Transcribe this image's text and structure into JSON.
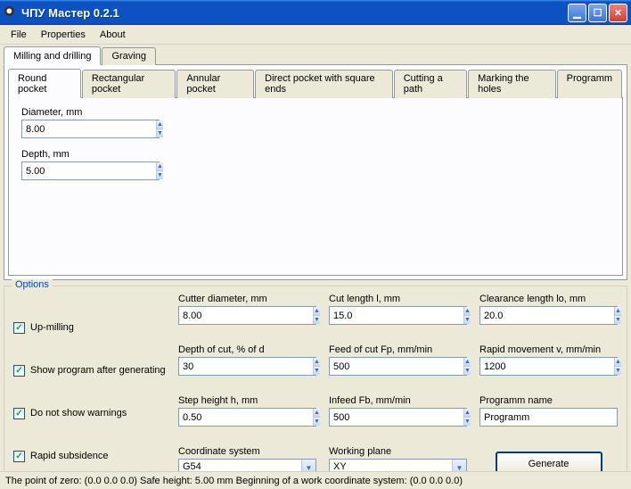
{
  "window": {
    "title": "ЧПУ Мастер 0.2.1"
  },
  "menu": {
    "file": "File",
    "properties": "Properties",
    "about": "About"
  },
  "outerTabs": {
    "milling": "Milling and drilling",
    "graving": "Graving"
  },
  "innerTabs": {
    "round": "Round pocket",
    "rect": "Rectangular pocket",
    "annular": "Annular pocket",
    "direct": "Direct pocket with square ends",
    "cutting": "Cutting a path",
    "marking": "Marking the holes",
    "programm": "Programm"
  },
  "roundPocket": {
    "diameterLabel": "Diameter, mm",
    "diameterValue": "8.00",
    "depthLabel": "Depth, mm",
    "depthValue": "5.00"
  },
  "options": {
    "legend": "Options",
    "upMilling": "Up-milling",
    "showProgram": "Show program after generating",
    "noWarnings": "Do not show warnings",
    "rapidSub": "Rapid subsidence",
    "cutterDiaLabel": "Cutter diameter, mm",
    "cutterDiaValue": "8.00",
    "depthCutLabel": "Depth of cut, % of d",
    "depthCutValue": "30",
    "stepHeightLabel": "Step height h, mm",
    "stepHeightValue": "0.50",
    "coordSysLabel": "Coordinate system",
    "coordSysValue": "G54",
    "cutLengthLabel": "Cut length l, mm",
    "cutLengthValue": "15.0",
    "feedCutLabel": "Feed of cut Fp, mm/min",
    "feedCutValue": "500",
    "infeedLabel": "Infeed Fb, mm/min",
    "infeedValue": "500",
    "workPlaneLabel": "Working plane",
    "workPlaneValue": "XY",
    "clearanceLabel": "Clearance length lo, mm",
    "clearanceValue": "20.0",
    "rapidMoveLabel": "Rapid movement v, mm/min",
    "rapidMoveValue": "1200",
    "progNameLabel": "Programm name",
    "progNameValue": "Programm",
    "generateLabel": "Generate"
  },
  "status": "The point of zero: (0.0  0.0  0.0)     Safe height: 5.00 mm    Beginning of a work coordinate system: (0.0  0.0  0.0)"
}
